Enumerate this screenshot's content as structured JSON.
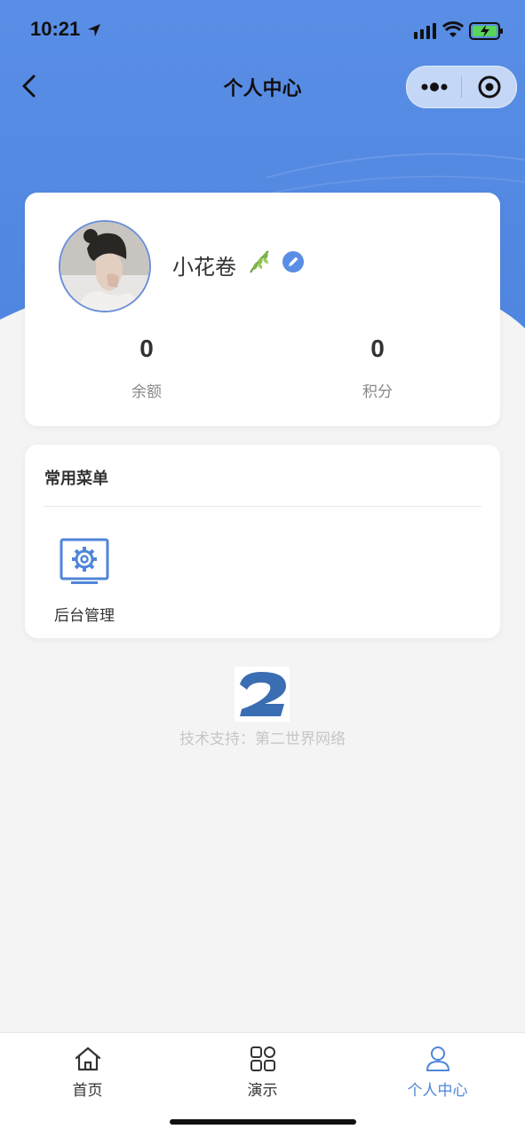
{
  "status_bar": {
    "time": "10:21"
  },
  "nav": {
    "title": "个人中心"
  },
  "profile": {
    "username": "小花卷",
    "stats": [
      {
        "value": "0",
        "label": "余额"
      },
      {
        "value": "0",
        "label": "积分"
      }
    ]
  },
  "menu": {
    "title": "常用菜单",
    "items": [
      {
        "label": "后台管理",
        "icon": "admin-settings-icon"
      }
    ]
  },
  "footer": {
    "support_text": "技术支持：第二世界网络"
  },
  "tabs": [
    {
      "label": "首页",
      "icon": "home-icon"
    },
    {
      "label": "演示",
      "icon": "grid-icon"
    },
    {
      "label": "个人中心",
      "icon": "user-icon",
      "active": true
    }
  ],
  "colors": {
    "accent": "#4f86d9",
    "header_bg": "#5a8ee6"
  }
}
